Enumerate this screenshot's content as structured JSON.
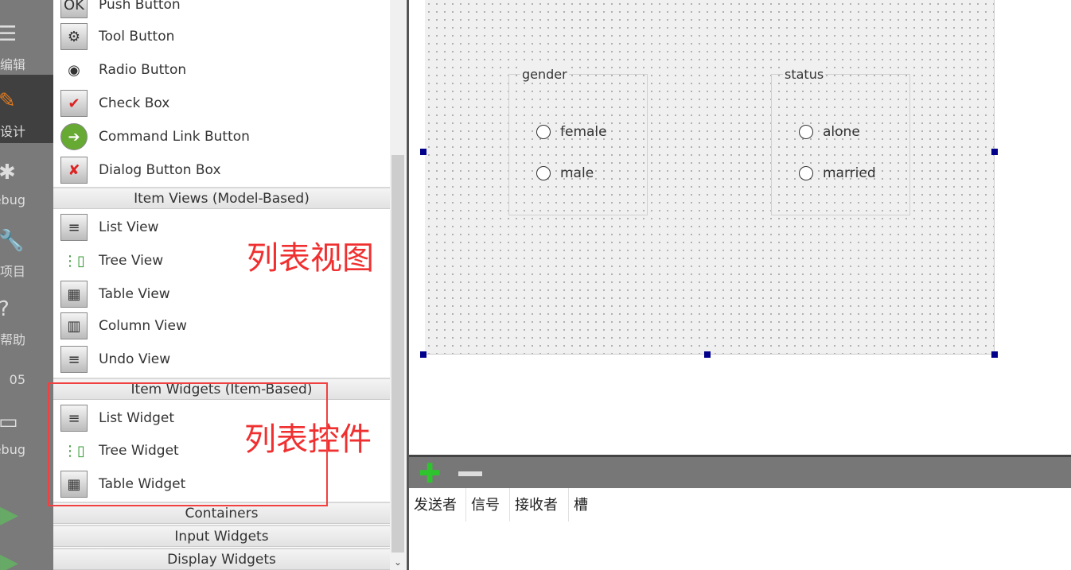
{
  "mode_bar": [
    {
      "label": "编辑",
      "icon": "edit-icon"
    },
    {
      "label": "设计",
      "icon": "design-icon",
      "active": true
    },
    {
      "label": "Debug",
      "icon": "debug-icon"
    },
    {
      "label": "项目",
      "icon": "projects-icon"
    },
    {
      "label": "帮助",
      "icon": "help-icon"
    },
    {
      "label": "05",
      "icon": ""
    },
    {
      "label": "Debug",
      "icon": "monitor-icon"
    }
  ],
  "widget_box": {
    "buttons": [
      "Push Button",
      "Tool Button",
      "Radio Button",
      "Check Box",
      "Command Link Button",
      "Dialog Button Box"
    ],
    "item_views_header": "Item Views (Model-Based)",
    "item_views": [
      "List View",
      "Tree View",
      "Table View",
      "Column View",
      "Undo View"
    ],
    "item_widgets_header": "Item Widgets (Item-Based)",
    "item_widgets": [
      "List Widget",
      "Tree Widget",
      "Table Widget"
    ],
    "containers": "Containers",
    "input_widgets": "Input Widgets",
    "display_widgets": "Display Widgets"
  },
  "annotations": {
    "views": "列表视图",
    "widgets": "列表控件",
    "color": "#f03030"
  },
  "form": {
    "gender": {
      "title": "gender",
      "options": [
        "female",
        "male"
      ]
    },
    "status": {
      "title": "status",
      "options": [
        "alone",
        "married"
      ]
    }
  },
  "signal_slot": {
    "columns": [
      "发送者",
      "信号",
      "接收者",
      "槽"
    ]
  }
}
